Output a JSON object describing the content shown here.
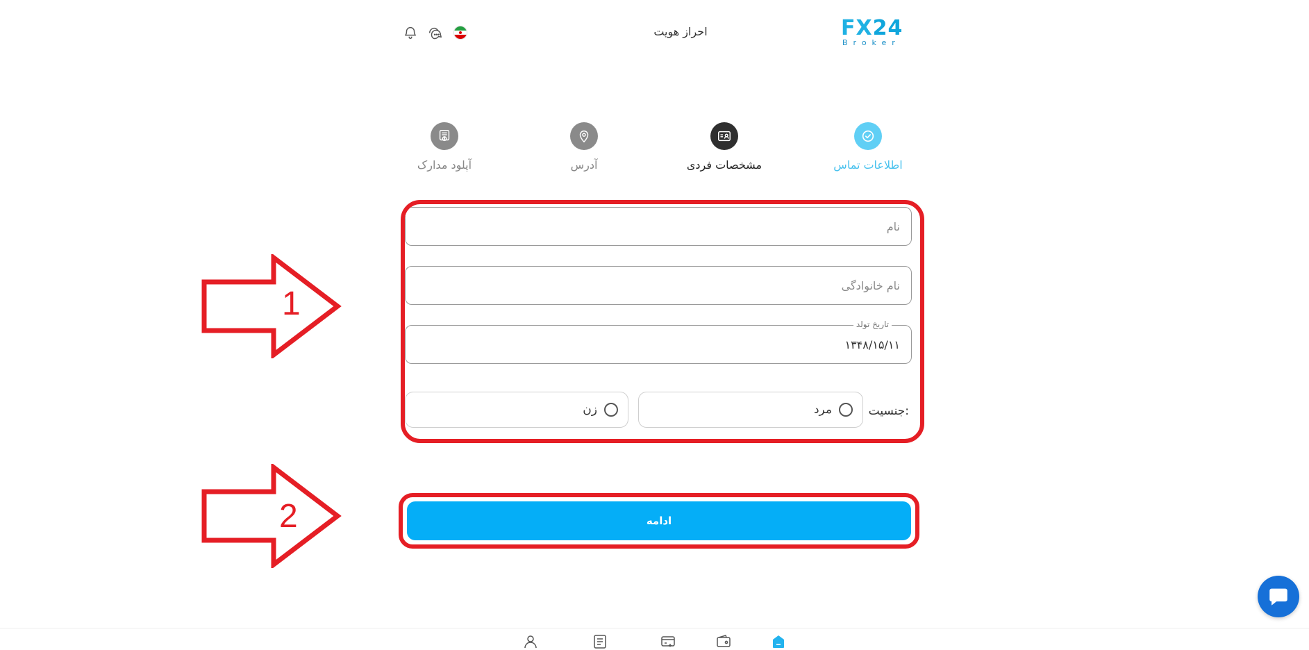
{
  "header": {
    "logo": "FX24 Broker",
    "logo_main_fx": "FX",
    "logo_main_num": "24",
    "logo_sub": "Broker",
    "title": "احراز هویت",
    "icons": [
      "bell-icon",
      "chat-icon",
      "iran-flag-icon"
    ]
  },
  "steps": [
    {
      "label": "اطلاعات تماس",
      "state": "done",
      "icon": "check-icon"
    },
    {
      "label": "مشخصات فردی",
      "state": "active",
      "icon": "id-card-icon"
    },
    {
      "label": "آدرس",
      "state": "todo",
      "icon": "location-pin-icon"
    },
    {
      "label": "آپلود مدارک",
      "state": "todo",
      "icon": "document-upload-icon"
    }
  ],
  "form": {
    "first_name": {
      "placeholder": "نام",
      "value": ""
    },
    "last_name": {
      "placeholder": "نام خانوادگی",
      "value": ""
    },
    "birth_date": {
      "label": "تاریخ تولد",
      "value": "۱۳۴۸/۱۵/۱۱"
    },
    "gender": {
      "label": "جنسیت:",
      "options": [
        {
          "label": "مرد",
          "selected": false
        },
        {
          "label": "زن",
          "selected": false
        }
      ]
    }
  },
  "continue_label": "ادامه",
  "annotations": {
    "arrow1": "1",
    "arrow2": "2"
  },
  "bottom_nav": [
    "home-icon",
    "wallet-icon",
    "card-transfer-icon",
    "list-icon",
    "user-icon"
  ],
  "colors": {
    "accent": "#05aef7",
    "step_done": "#60cff5",
    "step_active": "#2f2f2f",
    "step_todo": "#8a8a8a",
    "annotation_red": "#e51e25",
    "chat": "#1670d8"
  }
}
